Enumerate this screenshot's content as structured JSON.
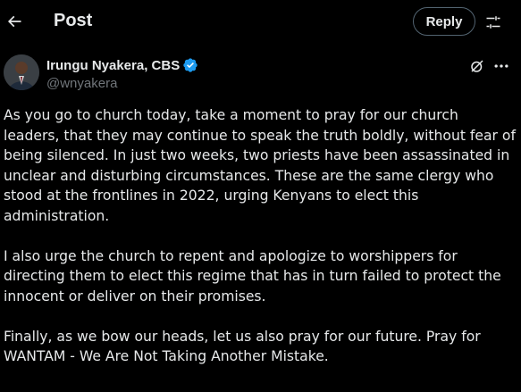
{
  "header": {
    "title": "Post",
    "reply_label": "Reply",
    "back_icon": "arrow-left-icon",
    "settings_icon": "sliders-icon"
  },
  "author": {
    "display_name": "Irungu Nyakera, CBS",
    "handle": "@wnyakera",
    "verified": true,
    "verified_color": "#1d9bf0"
  },
  "post": {
    "paragraphs": [
      "As you go to church today, take a moment to pray for our church leaders, that they may continue to speak the truth boldly, without fear of being silenced. In just two weeks, two priests have been assassinated in unclear and disturbing circumstances. These are the same clergy who stood at the frontlines in 2022, urging Kenyans to elect this administration.",
      "I also urge the church to repent and apologize to worshippers for directing them to elect this regime that has in turn failed to protect the innocent or deliver on their promises.",
      "Finally, as we bow our heads, let us also pray for our future. Pray for WANTAM - We Are Not Taking Another Mistake."
    ]
  },
  "colors": {
    "background": "#000000",
    "text": "#e7e9ea",
    "secondary_text": "#71767b",
    "border": "#536471"
  }
}
